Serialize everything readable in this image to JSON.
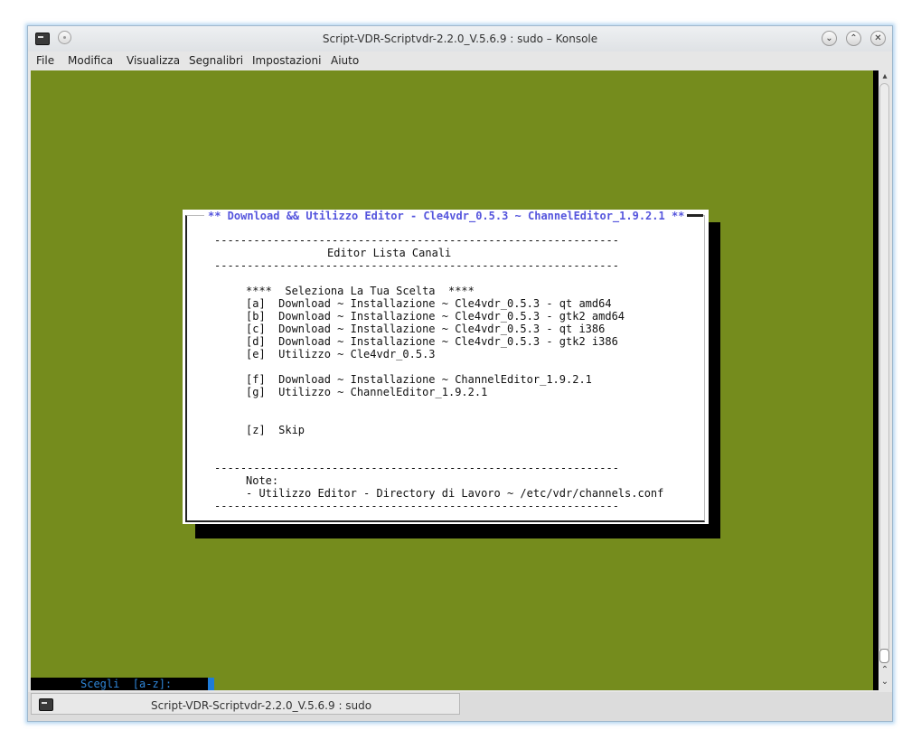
{
  "window": {
    "title": "Script-VDR-Scriptvdr-2.2.0_V.5.6.9 : sudo – Konsole",
    "buttons": {
      "minimize": "⌄",
      "maximize": "⌃",
      "close": "✕"
    }
  },
  "menubar": {
    "items": [
      "File",
      "Modifica",
      "Visualizza",
      "Segnalibri",
      "Impostazioni",
      "Aiuto"
    ]
  },
  "terminal": {
    "background": "#758c1d",
    "dialog": {
      "title": "** Download && Utilizzo Editor - Cle4vdr_0.5.3 ~ ChannelEditor_1.9.2.1 **",
      "separator": "--------------------------------------------------------------",
      "heading": "Editor Lista Canali",
      "prompt_line": "****  Seleziona La Tua Scelta  ****",
      "options": [
        "[a]  Download ~ Installazione ~ Cle4vdr_0.5.3 - qt amd64",
        "[b]  Download ~ Installazione ~ Cle4vdr_0.5.3 - gtk2 amd64",
        "[c]  Download ~ Installazione ~ Cle4vdr_0.5.3 - qt i386",
        "[d]  Download ~ Installazione ~ Cle4vdr_0.5.3 - gtk2 i386",
        "[e]  Utilizzo ~ Cle4vdr_0.5.3",
        "[f]  Download ~ Installazione ~ ChannelEditor_1.9.2.1",
        "[g]  Utilizzo ~ ChannelEditor_1.9.2.1",
        "[z]  Skip"
      ],
      "note_label": "Note:",
      "note_text": "- Utilizzo Editor - Directory di Lavoro ~ /etc/vdr/channels.conf"
    },
    "input_prompt": "Scegli  [a-z]:"
  },
  "taskbar": {
    "tab_label": "Script-VDR-Scriptvdr-2.2.0_V.5.6.9 : sudo"
  }
}
